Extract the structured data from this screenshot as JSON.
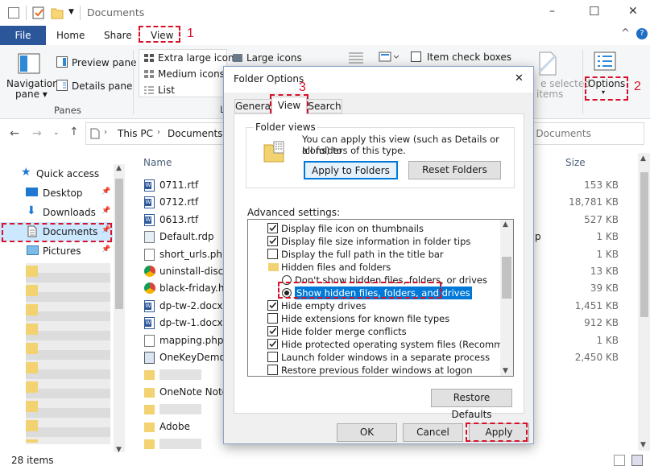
{
  "window": {
    "title": "Documents",
    "minimize": "–",
    "maximize": "☐",
    "close": "✕",
    "collapse": "^",
    "help": "?"
  },
  "ribbon": {
    "tabs": [
      "File",
      "Home",
      "Share",
      "View"
    ],
    "navigation_pane": "Navigation",
    "navigation_pane2": "pane ▾",
    "preview_pane": "Preview pane",
    "details_pane": "Details pane",
    "panes_group": "Panes",
    "layout": [
      "Extra large icons",
      "Large icons",
      "Medium icons",
      "List"
    ],
    "item_check_boxes": "Item check boxes",
    "hide_selected_1": "e selected",
    "hide_selected_2": "items",
    "options": "Options",
    "options_arrow": "▾",
    "layout_group_fragment": "L"
  },
  "address": {
    "path": [
      "This PC",
      "Documents"
    ],
    "search_placeholder": "h Documents"
  },
  "nav": {
    "quick_access": "Quick access",
    "items": [
      "Desktop",
      "Downloads",
      "Documents",
      "Pictures"
    ]
  },
  "files": {
    "col_name": "Name",
    "col_size": "Size",
    "rows": [
      {
        "name": "0711.rtf",
        "extra": "",
        "size": "153 KB"
      },
      {
        "name": "0712.rtf",
        "extra": "",
        "size": "18,781 KB"
      },
      {
        "name": "0613.rtf",
        "extra": "",
        "size": "527 KB"
      },
      {
        "name": "Default.rdp",
        "extra": "p",
        "size": "1 KB"
      },
      {
        "name": "short_urls.php",
        "extra": "",
        "size": "1 KB"
      },
      {
        "name": "uninstall-discou",
        "extra": "",
        "size": "13 KB"
      },
      {
        "name": "black-friday.htm",
        "extra": "",
        "size": "39 KB"
      },
      {
        "name": "dp-tw-2.docx",
        "extra": "",
        "size": "1,451 KB"
      },
      {
        "name": "dp-tw-1.docx",
        "extra": "",
        "size": "912 KB"
      },
      {
        "name": "mapping.php",
        "extra": "",
        "size": "1 KB"
      },
      {
        "name": "OneKeyDemo.e",
        "extra": "",
        "size": "2,450 KB"
      },
      {
        "name": "",
        "extra": "",
        "size": ""
      },
      {
        "name": "OneNote Notebo",
        "extra": "",
        "size": ""
      },
      {
        "name": "",
        "extra": "",
        "size": ""
      },
      {
        "name": "Adobe",
        "extra": "",
        "size": ""
      },
      {
        "name": "",
        "extra": "",
        "size": ""
      }
    ]
  },
  "status": {
    "count": "28 items"
  },
  "dialog": {
    "title": "Folder Options",
    "close": "✕",
    "tabs": [
      "General",
      "View",
      "Search"
    ],
    "folder_views_label": "Folder views",
    "folder_views_text1": "You can apply this view (such as Details or Icons) to",
    "folder_views_text2": "all folders of this type.",
    "apply_to_folders": "Apply to Folders",
    "reset_folders": "Reset Folders",
    "advanced_label": "Advanced settings:",
    "advanced_items": [
      {
        "label": "Display file icon on thumbnails",
        "type": "check",
        "checked": true
      },
      {
        "label": "Display file size information in folder tips",
        "type": "check",
        "checked": true
      },
      {
        "label": "Display the full path in the title bar",
        "type": "check",
        "checked": false
      },
      {
        "label": "Hidden files and folders",
        "type": "folder",
        "checked": false
      },
      {
        "label": "Don't show hidden files, folders, or drives",
        "type": "radio",
        "checked": false
      },
      {
        "label": "Show hidden files, folders, and drives",
        "type": "radio",
        "checked": true
      },
      {
        "label": "Hide empty drives",
        "type": "check",
        "checked": true
      },
      {
        "label": "Hide extensions for known file types",
        "type": "check",
        "checked": false
      },
      {
        "label": "Hide folder merge conflicts",
        "type": "check",
        "checked": true
      },
      {
        "label": "Hide protected operating system files (Recommended)",
        "type": "check",
        "checked": true
      },
      {
        "label": "Launch folder windows in a separate process",
        "type": "check",
        "checked": false
      },
      {
        "label": "Restore previous folder windows at logon",
        "type": "check",
        "checked": false
      }
    ],
    "restore_defaults": "Restore Defaults",
    "ok": "OK",
    "cancel": "Cancel",
    "apply": "Apply"
  },
  "annotations": [
    "1",
    "2",
    "3"
  ],
  "colors": {
    "file_tab": "#2b579a",
    "selection": "#0078d7",
    "annotation": "#d8112b",
    "nav_selected": "#cce8ff"
  }
}
